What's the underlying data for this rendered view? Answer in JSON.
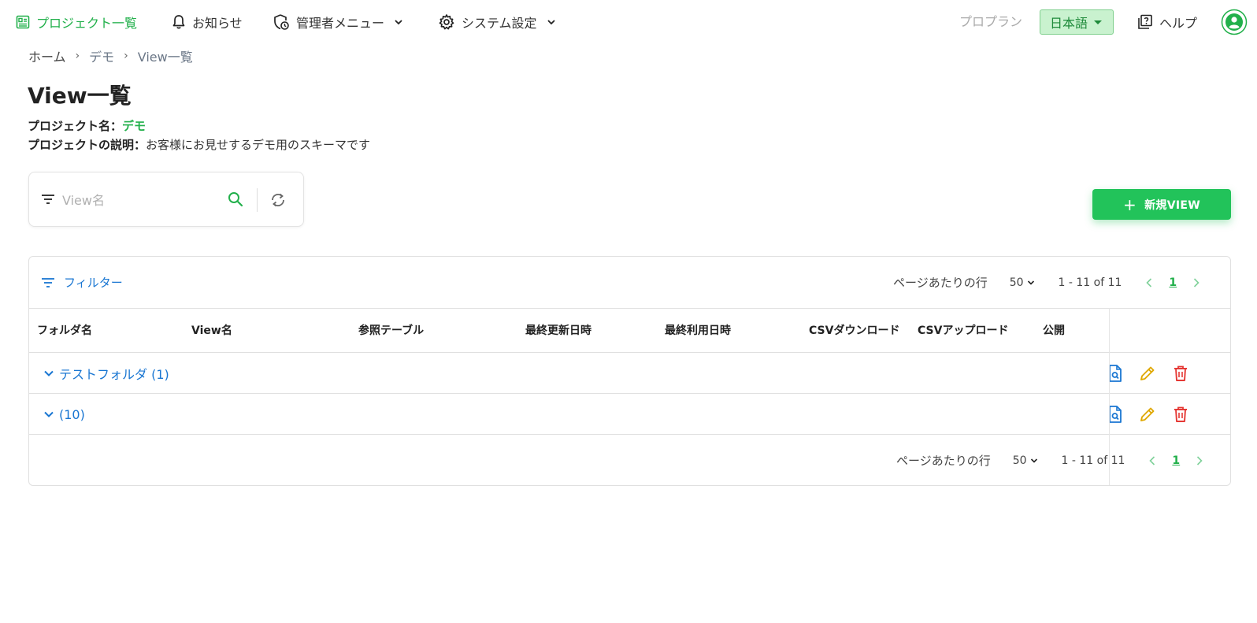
{
  "nav": {
    "projects": "プロジェクト一覧",
    "notifications": "お知らせ",
    "admin_menu": "管理者メニュー",
    "system_settings": "システム設定",
    "plan": "プロプラン",
    "language": "日本語",
    "help": "ヘルプ"
  },
  "breadcrumb": [
    "ホーム",
    "デモ",
    "View一覧"
  ],
  "page": {
    "title": "View一覧",
    "project_name_label": "プロジェクト名：",
    "project_name": "デモ",
    "project_desc_label": "プロジェクトの説明：",
    "project_desc": "お客様にお見せするデモ用のスキーマです"
  },
  "search": {
    "placeholder": "View名"
  },
  "new_button": {
    "label": "新規VIEW"
  },
  "table": {
    "filter_label": "フィルター",
    "rows_per_page_label": "ページあたりの行",
    "rows_per_page": "50",
    "range": "1 - 11 of 11",
    "current_page": "1",
    "columns": [
      "フォルダ名",
      "View名",
      "参照テーブル",
      "最終更新日時",
      "最終利用日時",
      "CSVダウンロード",
      "CSVアップロード",
      "公開"
    ],
    "groups": [
      {
        "label": "テストフォルダ (1)"
      },
      {
        "label": "(10)"
      }
    ]
  },
  "colors": {
    "accent_green": "#22c35a",
    "link_blue": "#1976d2",
    "edit_yellow": "#e0a800",
    "delete_red": "#e53935"
  }
}
